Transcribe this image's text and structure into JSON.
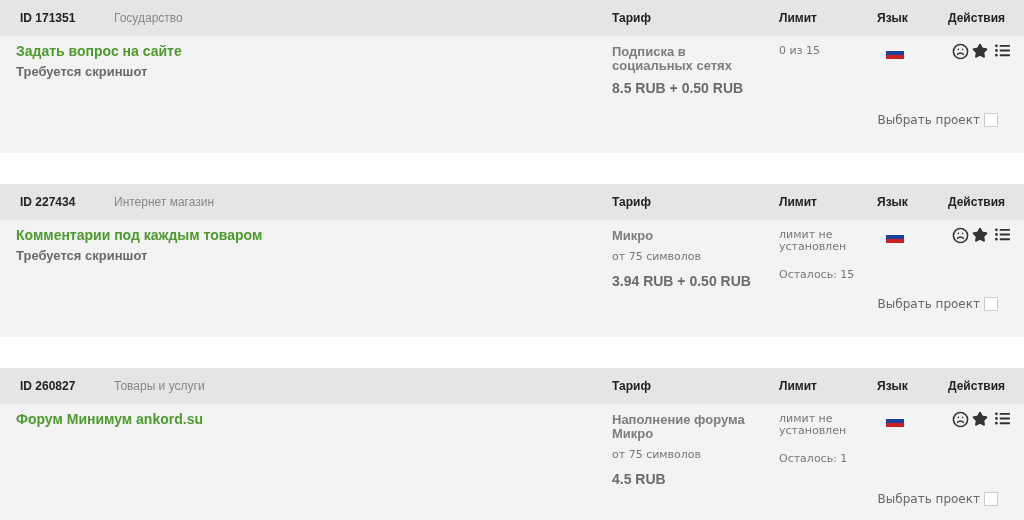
{
  "projects": [
    {
      "id": "ID 171351",
      "category": "Государство",
      "columns": [
        "Тариф",
        "Лимит",
        "Язык",
        "Действия"
      ],
      "title": "Задать вопрос на сайте",
      "note": "Требуется скриншот",
      "tariff": {
        "name": "Подписка в социальных сетях",
        "price": "8.5 RUB + 0.50 RUB"
      },
      "limit": {
        "text": "0 из 15"
      },
      "select_label": "Выбрать проект",
      "checked": false
    },
    {
      "id": "ID 227434",
      "category": "Интернет магазин",
      "columns": [
        "Тариф",
        "Лимит",
        "Язык",
        "Действия"
      ],
      "title": "Комментарии под каждым товаром",
      "note": "Требуется скриншот",
      "tariff": {
        "name": "Микро",
        "subtitle": "от 75 символов",
        "price": "3.94 RUB + 0.50 RUB"
      },
      "limit": {
        "text": "лимит не установлен",
        "remaining": "Осталось: 15"
      },
      "select_label": "Выбрать проект",
      "checked": false
    },
    {
      "id": "ID 260827",
      "category": "Товары и услуги",
      "columns": [
        "Тариф",
        "Лимит",
        "Язык",
        "Действия"
      ],
      "title": "Форум Минимум ankord.su",
      "tariff": {
        "name": "Наполнение форума Микро",
        "subtitle": "от 75 символов",
        "price": "4.5 RUB"
      },
      "limit": {
        "text": "лимит не установлен",
        "remaining": "Осталось: 1"
      },
      "select_label": "Выбрать проект",
      "checked": false
    }
  ]
}
